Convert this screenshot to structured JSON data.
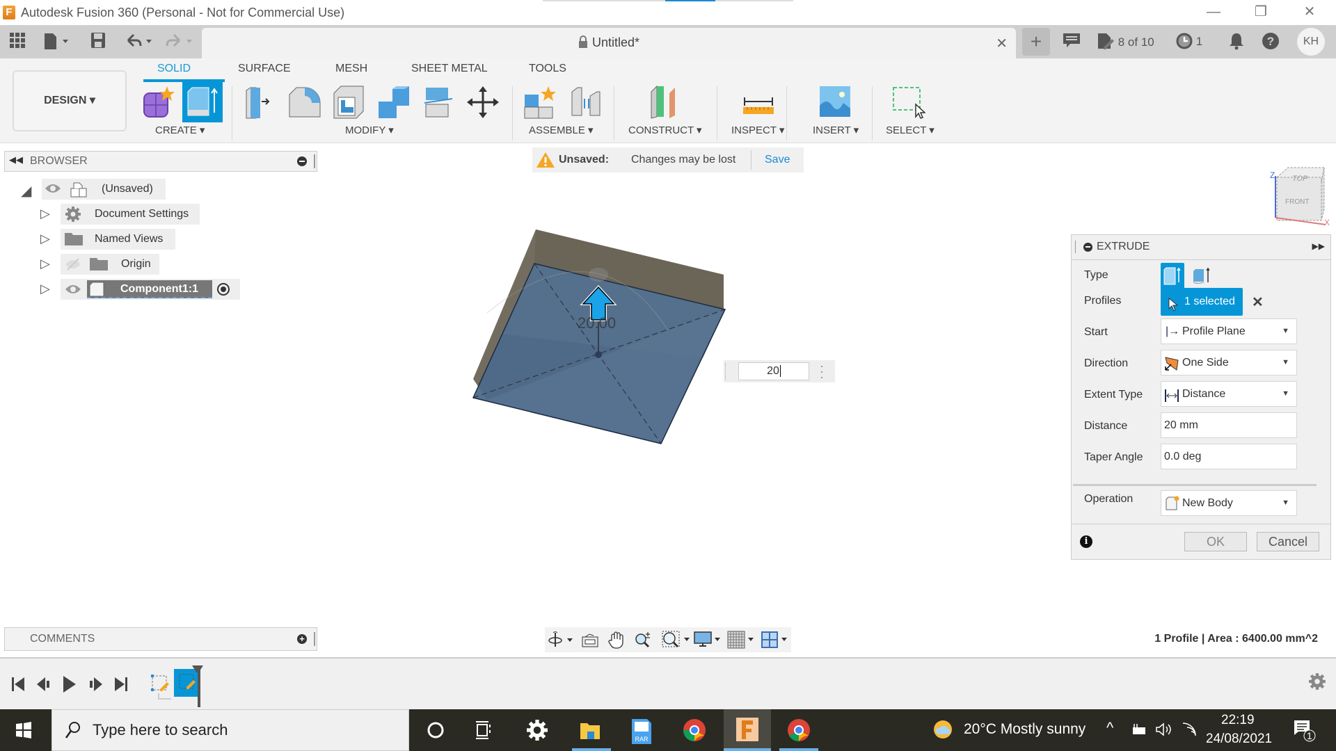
{
  "window": {
    "title": "Autodesk Fusion 360 (Personal - Not for Commercial Use)",
    "logo": "F",
    "controls": {
      "minimize": "—",
      "restore": "❐",
      "close": "✕"
    }
  },
  "topbar": {
    "document_title": "Untitled*",
    "close_tab": "✕",
    "new_tab": "+",
    "data_count": "8 of 10",
    "jobs_count": "1",
    "user_initials": "KH"
  },
  "ribbon": {
    "workspace": "DESIGN ▾",
    "tabs": [
      {
        "label": "SOLID",
        "active": true
      },
      {
        "label": "SURFACE",
        "active": false
      },
      {
        "label": "MESH",
        "active": false
      },
      {
        "label": "SHEET METAL",
        "active": false
      },
      {
        "label": "TOOLS",
        "active": false
      }
    ],
    "groups": [
      "CREATE ▾",
      "MODIFY ▾",
      "ASSEMBLE ▾",
      "CONSTRUCT ▾",
      "INSPECT ▾",
      "INSERT ▾",
      "SELECT ▾"
    ]
  },
  "browser": {
    "title": "BROWSER",
    "items": [
      {
        "label": "(Unsaved)",
        "icon": "component-icon",
        "expanded": true
      },
      {
        "label": "Document Settings",
        "icon": "gear-icon"
      },
      {
        "label": "Named Views",
        "icon": "folder-icon"
      },
      {
        "label": "Origin",
        "icon": "folder-icon",
        "hidden": true
      },
      {
        "label": "Component1:1",
        "icon": "body-icon",
        "active": true
      }
    ]
  },
  "banner": {
    "status": "Unsaved:",
    "message": "Changes may be lost",
    "action": "Save"
  },
  "viewport": {
    "dimension_label": "20.00",
    "inline_input_value": "20",
    "viewcube": {
      "top": "TOP",
      "front": "FRONT",
      "axis_z": "Z",
      "axis_x": "X"
    }
  },
  "extrude": {
    "title": "EXTRUDE",
    "fields": {
      "type_label": "Type",
      "profiles_label": "Profiles",
      "profiles_value": "1 selected",
      "start_label": "Start",
      "start_value": "Profile Plane",
      "direction_label": "Direction",
      "direction_value": "One Side",
      "extent_label": "Extent Type",
      "extent_value": "Distance",
      "distance_label": "Distance",
      "distance_value": "20 mm",
      "taper_label": "Taper Angle",
      "taper_value": "0.0 deg",
      "operation_label": "Operation",
      "operation_value": "New Body"
    },
    "ok": "OK",
    "cancel": "Cancel"
  },
  "comments": {
    "title": "COMMENTS"
  },
  "status": {
    "profile_info": "1 Profile | Area : 6400.00 mm^2"
  },
  "taskbar": {
    "search_placeholder": "Type here to search",
    "weather": "20°C  Mostly sunny",
    "time": "22:19",
    "date": "24/08/2021",
    "notifications": "1"
  },
  "colors": {
    "accent": "#0696d7",
    "body_face": "#4d6a8a",
    "body_side": "#6b6557"
  }
}
